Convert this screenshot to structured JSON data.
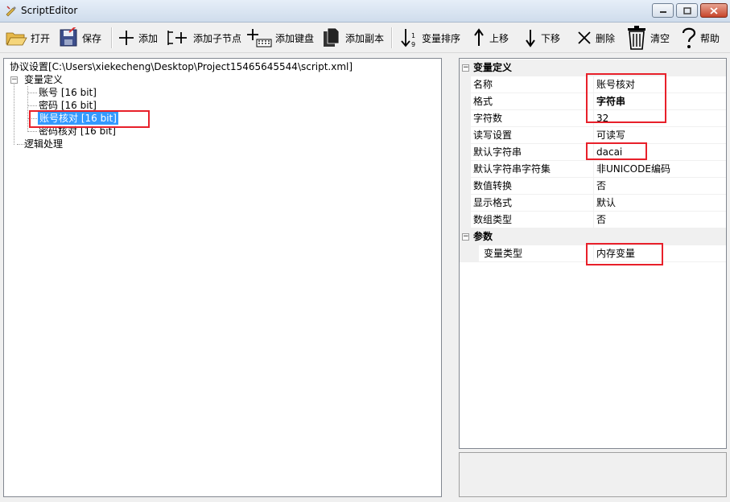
{
  "window": {
    "title": "ScriptEditor",
    "min_icon": "minimize-icon",
    "max_icon": "maximize-icon",
    "close_icon": "close-icon"
  },
  "toolbar": {
    "open": "打开",
    "save": "保存",
    "add": "添加",
    "add_child": "添加子节点",
    "add_keyboard": "添加键盘",
    "add_copy": "添加副本",
    "sort_vars": "变量排序",
    "move_up": "上移",
    "move_down": "下移",
    "delete": "删除",
    "clear": "清空",
    "help": "帮助"
  },
  "tree": {
    "root": "协议设置[C:\\Users\\xiekecheng\\Desktop\\Project15465645544\\script.xml]",
    "var_def": "变量定义",
    "items": [
      "账号 [16 bit]",
      "密码 [16 bit]",
      "账号核对 [16 bit]",
      "密码核对 [16 bit]"
    ],
    "logic": "逻辑处理"
  },
  "properties": {
    "cat_var_def": "变量定义",
    "rows": [
      {
        "name": "名称",
        "value": "账号核对"
      },
      {
        "name": "格式",
        "value": "字符串"
      },
      {
        "name": "字符数",
        "value": "32"
      },
      {
        "name": "读写设置",
        "value": "可读写"
      },
      {
        "name": "默认字符串",
        "value": "dacai"
      },
      {
        "name": "默认字符串字符集",
        "value": "非UNICODE编码"
      },
      {
        "name": "数值转换",
        "value": "否"
      },
      {
        "name": "显示格式",
        "value": "默认"
      },
      {
        "name": "数组类型",
        "value": "否"
      }
    ],
    "cat_params": "参数",
    "param_rows": [
      {
        "name": "变量类型",
        "value": "内存变量"
      }
    ]
  },
  "colors": {
    "selection": "#3399ff",
    "highlight_box": "#e8202a"
  }
}
